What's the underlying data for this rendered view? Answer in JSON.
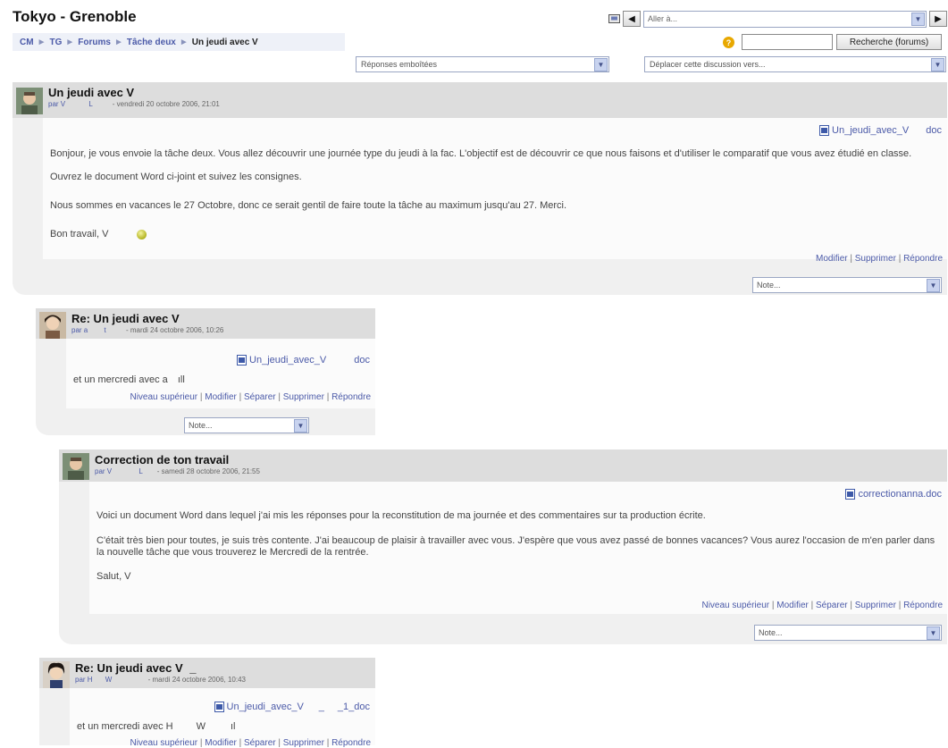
{
  "header": {
    "site_title": "Tokyo - Grenoble",
    "jump_placeholder": "Aller à..."
  },
  "breadcrumb": {
    "items": [
      "CM",
      "TG",
      "Forums",
      "Tâche deux"
    ],
    "current": "Un jeudi avec V"
  },
  "search": {
    "button_label": "Recherche (forums)",
    "help_icon": "?"
  },
  "discussion_controls": {
    "display_mode": "Réponses emboîtées",
    "move_to": "Déplacer cette discussion vers..."
  },
  "posts": [
    {
      "title": "Un jeudi avec V",
      "author_prefix": "par V",
      "author_initial": "L",
      "date": "- vendredi 20 octobre 2006, 21:01",
      "attachment": "Un_jeudi_avec_V",
      "attachment_ext": "doc",
      "p1": "Bonjour, je vous envoie la tâche deux. Vous allez découvrir une journée type du jeudi à la fac. L'objectif est de découvrir ce que nous faisons et d'utiliser le comparatif que vous avez étudié en classe.",
      "p2": "Ouvrez le document Word ci-joint et suivez les consignes.",
      "p3": "Nous sommes en vacances le 27 Octobre, donc ce serait gentil de faire toute la tâche au maximum jusqu'au 27. Merci.",
      "p4": "Bon travail, V",
      "actions": [
        "Modifier",
        "Supprimer",
        "Répondre"
      ],
      "rating": "Note..."
    },
    {
      "title": "Re: Un jeudi avec V",
      "author_prefix": "par a",
      "author_initial": "t",
      "date": "- mardi 24 octobre 2006, 10:26",
      "attachment": "Un_jeudi_avec_V",
      "attachment_ext": "doc",
      "p1": "et un mercredi avec a",
      "p1_tail": "ıll",
      "actions": [
        "Niveau supérieur",
        "Modifier",
        "Séparer",
        "Supprimer",
        "Répondre"
      ],
      "rating": "Note..."
    },
    {
      "title": "Correction de ton travail",
      "author_prefix": "par V",
      "author_initial": "L",
      "date": "- samedi 28 octobre 2006, 21:55",
      "attachment": "correctionanna.doc",
      "p1": "Voici un document Word dans lequel j'ai mis les réponses pour la reconstitution de ma journée et des commentaires sur ta production écrite.",
      "p2": "C'était très bien pour toutes, je suis très contente. J'ai beaucoup de plaisir à travailler avec vous. J'espère que vous avez passé de bonnes vacances? Vous aurez l'occasion de m'en parler dans la nouvelle tâche que vous trouverez le Mercredi de la rentrée.",
      "p3": "Salut, V",
      "actions": [
        "Niveau supérieur",
        "Modifier",
        "Séparer",
        "Supprimer",
        "Répondre"
      ],
      "rating": "Note..."
    },
    {
      "title": "Re: Un jeudi avec V",
      "title_tail": "_",
      "author_prefix": "par H",
      "author_initial": "W",
      "date": "- mardi 24 octobre 2006, 10:43",
      "attachment": "Un_jeudi_avec_V",
      "attachment_mid": "_",
      "attachment_ext": "_1_doc",
      "p1": "et un mercredi avec H",
      "p1_mid": "W",
      "p1_tail": "ıl",
      "actions": [
        "Niveau supérieur",
        "Modifier",
        "Séparer",
        "Supprimer",
        "Répondre"
      ]
    }
  ],
  "colors": {
    "link": "#4b5aa8",
    "header_band": "#dddddd",
    "post_bg": "#f0f0f0"
  },
  "icons": [
    "bookmark-icon",
    "prev-arrow-icon",
    "next-arrow-icon",
    "help-icon",
    "word-doc-icon",
    "smiley-icon",
    "select-arrow-icon"
  ]
}
